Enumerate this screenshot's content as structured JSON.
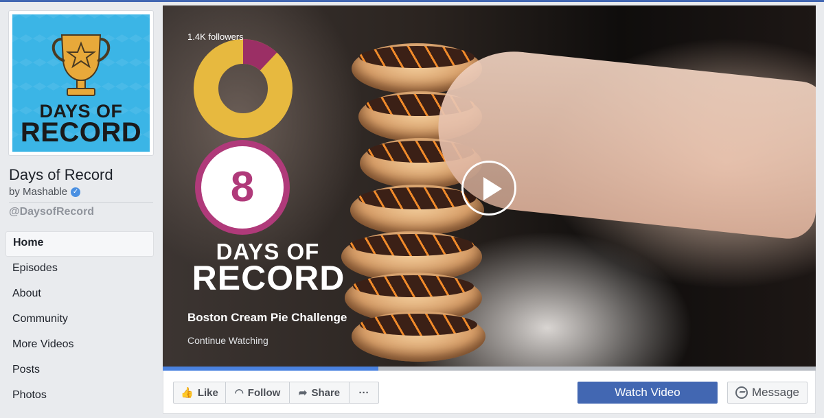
{
  "page": {
    "name": "Days of Record",
    "by_line": "by Mashable",
    "handle": "@DaysofRecord",
    "profile_logo": {
      "line1": "DAYS OF",
      "line2": "RECORD"
    }
  },
  "nav": {
    "items": [
      "Home",
      "Episodes",
      "About",
      "Community",
      "More Videos",
      "Posts",
      "Photos"
    ],
    "active": "Home"
  },
  "cover": {
    "followers_label": "1.4K followers",
    "followers_chart": {
      "type": "donut",
      "highlight_fraction": 0.12,
      "colors": {
        "main": "#e7b93f",
        "highlight": "#9b2f65"
      }
    },
    "badge_number": "8",
    "title_line1": "DAYS OF",
    "title_line2": "RECORD",
    "episode_title": "Boston Cream Pie Challenge",
    "continue_label": "Continue Watching",
    "progress": 0.33
  },
  "actions": {
    "like": "Like",
    "follow": "Follow",
    "share": "Share",
    "more": "···",
    "watch_video": "Watch Video",
    "message": "Message"
  },
  "colors": {
    "brand_blue": "#4267b2",
    "badge_magenta": "#b03a7a",
    "profile_bg": "#3bb5e6"
  }
}
